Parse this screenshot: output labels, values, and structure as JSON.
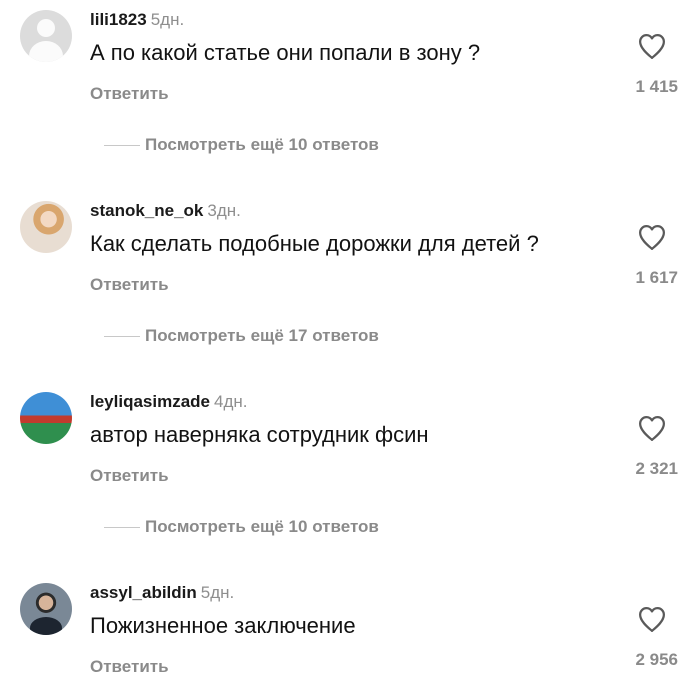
{
  "comments": [
    {
      "username": "lili1823",
      "age": "5дн.",
      "text": "А по какой статье они попали в зону ?",
      "reply_label": "Ответить",
      "likes": "1 415",
      "more_replies": "Посмотреть ещё 10 ответов",
      "avatar": "default-avatar-icon"
    },
    {
      "username": "stanok_ne_ok",
      "age": "3дн.",
      "text": "Как сделать подобные дорожки для детей ?",
      "reply_label": "Ответить",
      "likes": "1 617",
      "more_replies": "Посмотреть ещё 17 ответов",
      "avatar": "user-photo"
    },
    {
      "username": "leyliqasimzade",
      "age": "4дн.",
      "text": "автор наверняка сотрудник фсин",
      "reply_label": "Ответить",
      "likes": "2 321",
      "more_replies": "Посмотреть ещё 10 ответов",
      "avatar": "user-photo"
    },
    {
      "username": "assyl_abildin",
      "age": "5дн.",
      "text": "Пожизненное заключение",
      "reply_label": "Ответить",
      "likes": "2 956",
      "avatar": "user-photo"
    }
  ],
  "colors": {
    "text": "#121212",
    "muted": "#8a8a8a",
    "divider": "#c8c8c8"
  }
}
